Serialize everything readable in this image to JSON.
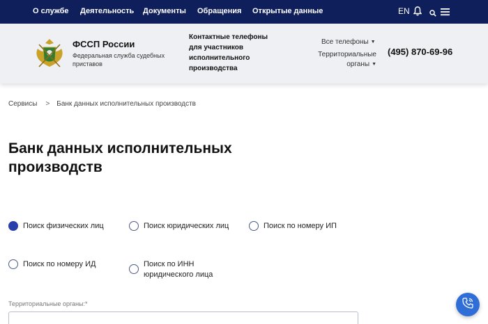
{
  "topnav": {
    "items": [
      "О службе",
      "Деятельность",
      "Документы",
      "Обращения",
      "Открытые данные"
    ],
    "lang": "EN"
  },
  "header": {
    "org_name": "ФССП России",
    "org_subtitle": "Федеральная служба судебных приставов",
    "contacts_title": "Контактные телефоны для участников исполнительного производства",
    "all_phones": "Все телефоны",
    "territorial_bodies": "Территориальные органы",
    "phone": "(495) 870-69-96"
  },
  "breadcrumb": {
    "root": "Сервисы",
    "separator": ">",
    "current": "Банк данных исполнительных производств"
  },
  "page_title": "Банк данных исполнительных производств",
  "search_options": [
    {
      "label": "Поиск физических лиц",
      "checked": true
    },
    {
      "label": "Поиск юридических лиц",
      "checked": false
    },
    {
      "label": "Поиск по номеру ИП",
      "checked": false
    },
    {
      "label": "Поиск по номеру ИД",
      "checked": false
    },
    {
      "label": "Поиск по ИНН юридического лица",
      "checked": false
    }
  ],
  "form": {
    "territorial_label": "Территориальные органы:*"
  },
  "colors": {
    "nav_bg": "#0f1f5c",
    "header_bg": "#eef0f3",
    "radio_checked": "#2b3faa",
    "fab_bg": "#2f6ed6"
  }
}
